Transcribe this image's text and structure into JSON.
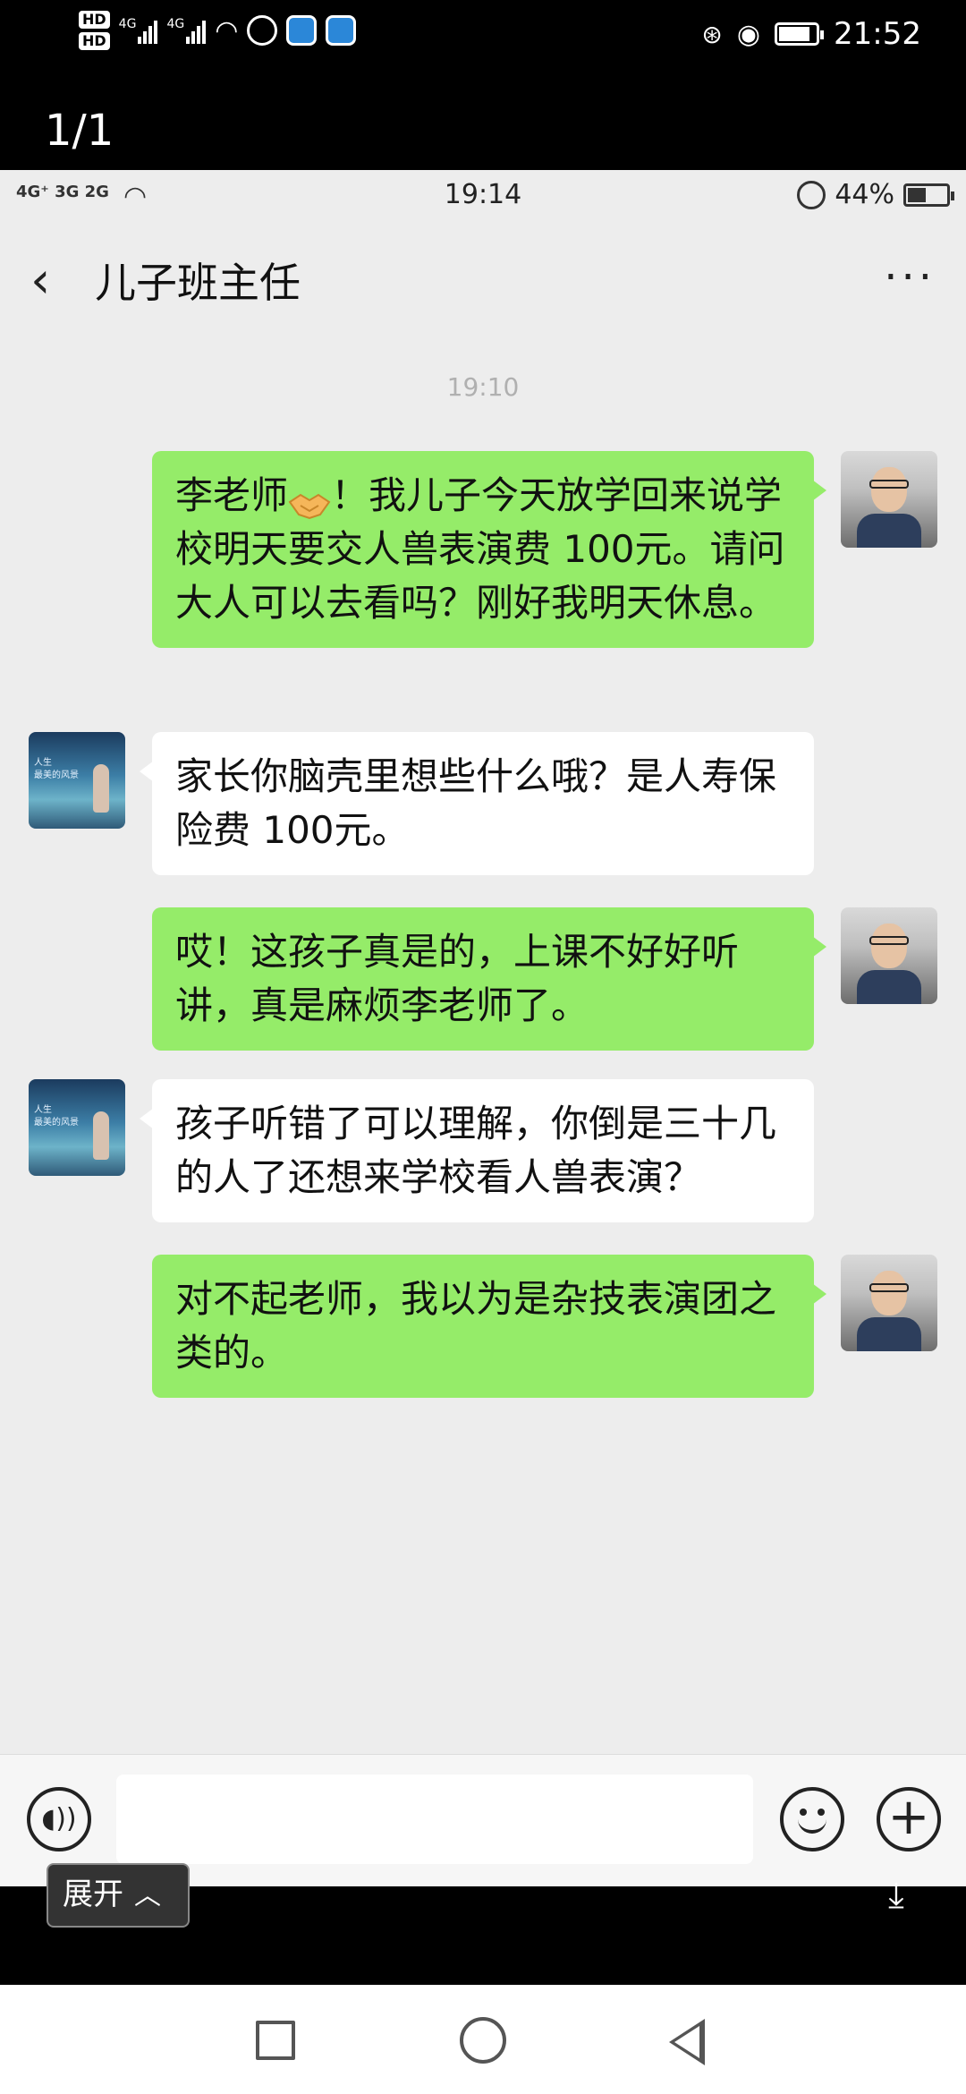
{
  "outer_status": {
    "time": "21:52",
    "hd1": "HD",
    "hd2": "HD",
    "net1": "4G",
    "net2": "4G"
  },
  "viewer": {
    "counter": "1/1",
    "expand_label": "展开"
  },
  "inner_status": {
    "network": "4G⁺ 3G 2G",
    "time": "19:14",
    "battery": "44%"
  },
  "chat": {
    "title": "儿子班主任",
    "timestamp": "19:10",
    "messages": [
      {
        "sender": "me",
        "text_before_emoji": "李老师",
        "emoji": "handshake",
        "text_after_emoji": "！我儿子今天放学回来说学校明天要交人兽表演费 100元。请问大人可以去看吗？刚好我明天休息。"
      },
      {
        "sender": "teacher",
        "text": "家长你脑壳里想些什么哦？是人寿保险费 100元。"
      },
      {
        "sender": "me",
        "text": "哎！这孩子真是的，上课不好好听讲，真是麻烦李老师了。"
      },
      {
        "sender": "teacher",
        "text": "孩子听错了可以理解，你倒是三十几的人了还想来学校看人兽表演？"
      },
      {
        "sender": "me",
        "text": "对不起老师，我以为是杂技表演团之类的。"
      }
    ]
  },
  "icons": {
    "back": "chevron-left-icon",
    "more": "more-icon",
    "voice": "voice-icon",
    "emoji": "emoji-icon",
    "plus": "plus-icon",
    "download": "download-icon"
  },
  "colors": {
    "my_bubble": "#95ec69",
    "their_bubble": "#ffffff",
    "chat_bg": "#ededed"
  }
}
